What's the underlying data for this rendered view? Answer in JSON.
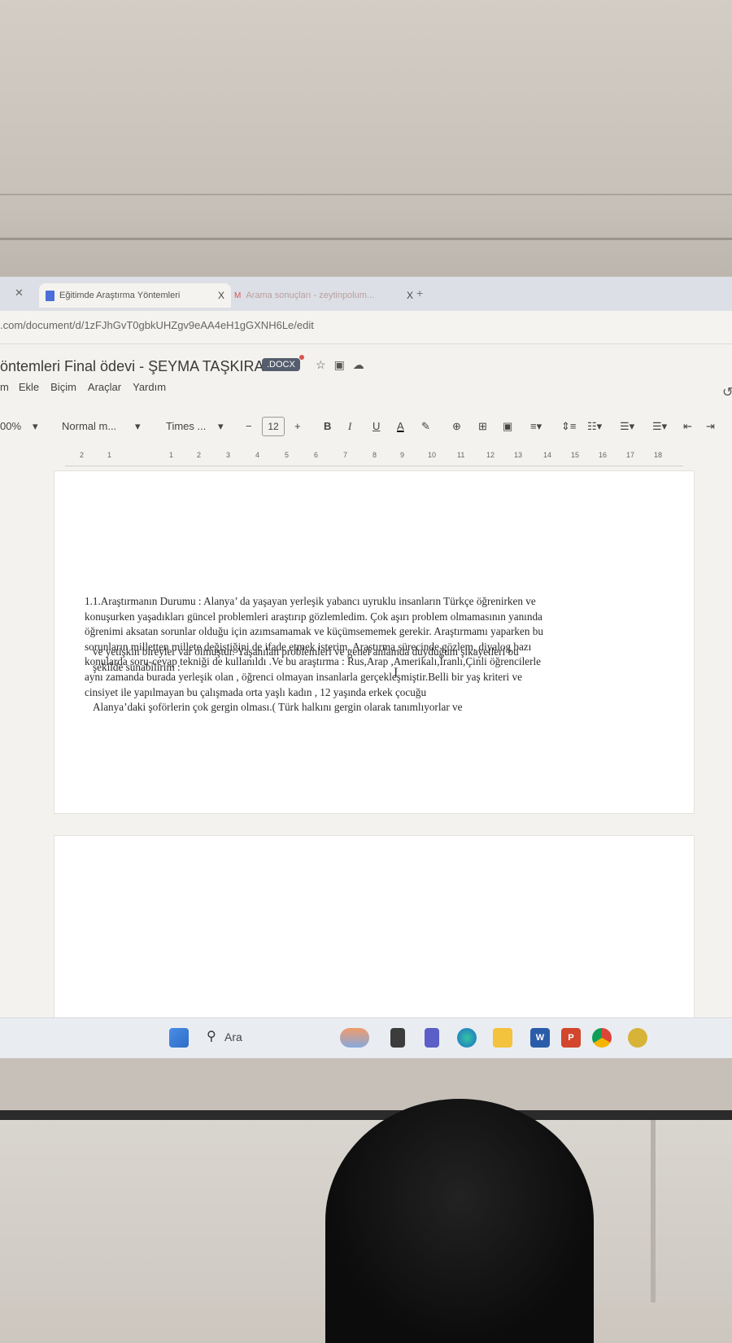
{
  "browser": {
    "tabs": [
      {
        "title": "Eğitimde Araştırma Yöntemleri",
        "close": "X"
      },
      {
        "title": "Arama sonuçları - zeytinpolum...",
        "close": "X"
      }
    ],
    "new_tab": "+",
    "url": ".com/document/d/1zFJhGvT0gbkUHZgv9eAA4eH1gGXNH6Le/edit"
  },
  "docs": {
    "title": "öntemleri Final ödevi - ŞEYMA TAŞKIRAN",
    "badge": ".DOCX",
    "menu": [
      "m",
      "Ekle",
      "Biçim",
      "Araçlar",
      "Yardım"
    ],
    "toolbar": {
      "zoom": "00%",
      "style": "Normal m...",
      "font": "Times ...",
      "minus": "−",
      "size": "12",
      "plus": "+",
      "bold": "B",
      "italic": "I",
      "underline": "U",
      "text_color": "A"
    },
    "ruler": [
      "2",
      "1",
      "1",
      "2",
      "3",
      "4",
      "5",
      "6",
      "7",
      "8",
      "9",
      "10",
      "11",
      "12",
      "13",
      "14",
      "15",
      "16",
      "17",
      "18"
    ]
  },
  "document": {
    "para1_lead": "1.1.Araştırmanın Durumu : ",
    "para1_body": "Alanya’ da yaşayan yerleşik yabancı uyruklu insanların Türkçe öğrenirken ve konuşurken yaşadıkları güncel problemleri araştırıp gözlemledim. Çok aşırı problem olmamasının yanında öğrenimi aksatan sorunlar olduğu için azımsamamak ve küçümsememek gerekir. Araştırmamı yaparken bu sorunların milletten millete değiştiğini de ifade etmek isterim. Araştırma sürecinde gözlem, diyalog bazı konularda soru-cevap tekniği de kullanıldı .Ve bu araştırma : Rus,Arap ,Amerikalı,İranlı,Çinli öğrencilerle aynı zamanda burada yerleşik olan , öğrenci olmayan insanlarla gerçekleşmiştir.Belli bir yaş kriteri ve cinsiyet ile yapılmayan bu çalışmada orta yaşlı kadın , 12 yaşında erkek çocuğu",
    "para2": "ve yetişkin bireyler var olmuştur.   Yaşanılan problemleri ve genel anlamda duyduğum şikayetleri bu şekilde sunabilirim :",
    "para3": "Alanya’daki şoförlerin çok gergin olması.( Türk halkını gergin olarak tanımlıyorlar ve"
  },
  "taskbar": {
    "search": "Ara",
    "word": "W",
    "ppt": "P"
  }
}
